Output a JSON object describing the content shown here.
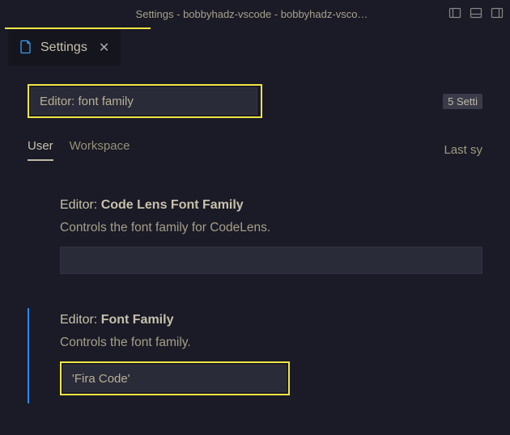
{
  "window": {
    "title": "Settings - bobbyhadz-vscode - bobbyhadz-vsco…"
  },
  "tab": {
    "label": "Settings"
  },
  "search": {
    "value": "Editor: font family",
    "count_badge": "5 Setti"
  },
  "scope": {
    "user": "User",
    "workspace": "Workspace",
    "last_sync": "Last sy"
  },
  "settings": {
    "codelens": {
      "prefix": "Editor: ",
      "bold": "Code Lens Font Family",
      "desc": "Controls the font family for CodeLens.",
      "value": ""
    },
    "fontFamily": {
      "prefix": "Editor: ",
      "bold": "Font Family",
      "desc": "Controls the font family.",
      "value": "'Fira Code'"
    }
  }
}
